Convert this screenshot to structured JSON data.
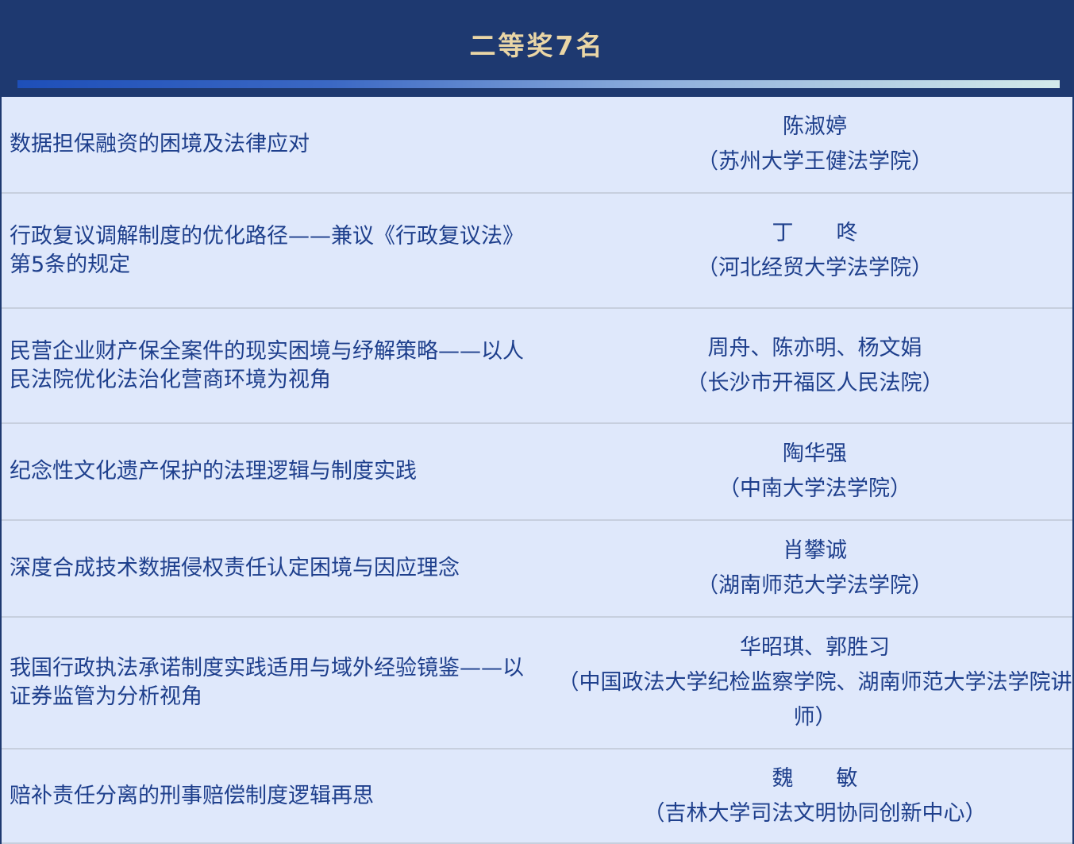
{
  "header": {
    "title": "二等奖7名"
  },
  "rows": [
    {
      "title": "数据担保融资的困境及法律应对",
      "author": "陈淑婷",
      "affiliation": "（苏州大学王健法学院）"
    },
    {
      "title": "行政复议调解制度的优化路径——兼议《行政复议法》第5条的规定",
      "author": "丁　　咚",
      "affiliation": "（河北经贸大学法学院）"
    },
    {
      "title": "民营企业财产保全案件的现实困境与纾解策略——以人民法院优化法治化营商环境为视角",
      "author": "周舟、陈亦明、杨文娟",
      "affiliation": "（长沙市开福区人民法院）"
    },
    {
      "title": "纪念性文化遗产保护的法理逻辑与制度实践",
      "author": "陶华强",
      "affiliation": "（中南大学法学院）"
    },
    {
      "title": "深度合成技术数据侵权责任认定困境与因应理念",
      "author": "肖攀诚",
      "affiliation": "（湖南师范大学法学院）"
    },
    {
      "title": "我国行政执法承诺制度实践适用与域外经验镜鉴——以证券监管为分析视角",
      "author": "华昭琪、郭胜习",
      "affiliation": "（中国政法大学纪检监察学院、湖南师范大学法学院讲师）"
    },
    {
      "title": "赔补责任分离的刑事赔偿制度逻辑再思",
      "author": "魏　　敏",
      "affiliation": "（吉林大学司法文明协同创新中心）"
    }
  ]
}
